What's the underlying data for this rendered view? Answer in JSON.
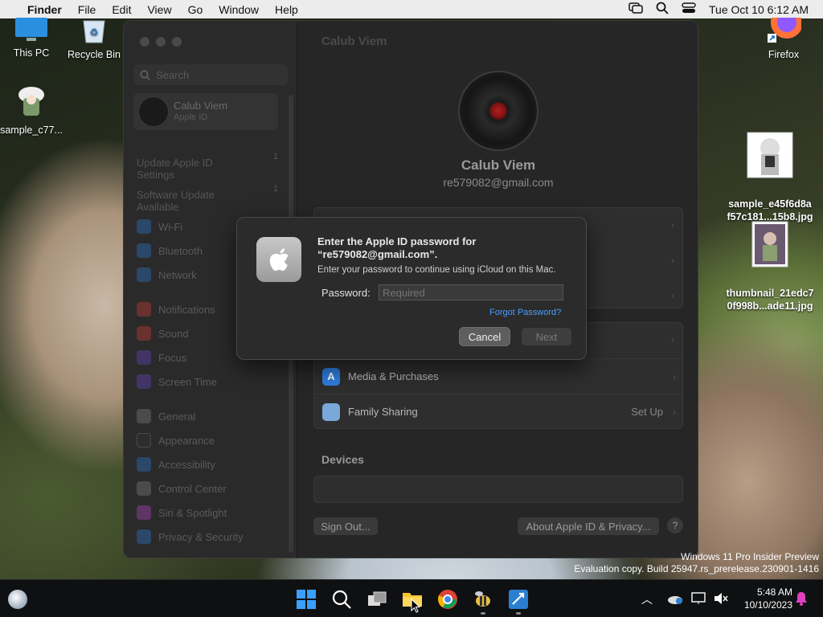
{
  "menubar": {
    "apple": "",
    "app": "Finder",
    "items": [
      "File",
      "Edit",
      "View",
      "Go",
      "Window",
      "Help"
    ],
    "clock": "Tue Oct 10  6:12 AM"
  },
  "desktop": {
    "icons": [
      {
        "label": "This PC"
      },
      {
        "label": "Recycle Bin"
      },
      {
        "label": "sample_c77..."
      },
      {
        "label": "Firefox"
      },
      {
        "label": "sample_e45f6d8a\nf57c181...15b8.jpg"
      },
      {
        "label": "thumbnail_21edc7\n0f998b...ade11.jpg"
      }
    ],
    "watermark": [
      "Windows 11 Pro Insider Preview",
      "Evaluation copy. Build 25947.rs_prerelease.230901-1416"
    ]
  },
  "window": {
    "title": "Calub Viem",
    "search_placeholder": "Search",
    "profile": {
      "name": "Calub Viem",
      "sub": "Apple ID"
    },
    "updates": [
      {
        "label": "Update Apple ID\nSettings",
        "badge": "1"
      },
      {
        "label": "Software Update\nAvailable",
        "badge": "1"
      }
    ],
    "sidebar": [
      "Wi-Fi",
      "Bluetooth",
      "Network",
      "Notifications",
      "Sound",
      "Focus",
      "Screen Time",
      "General",
      "Appearance",
      "Accessibility",
      "Control Center",
      "Siri & Spotlight",
      "Privacy & Security"
    ],
    "header": {
      "name": "Calub Viem",
      "email": "re579082@gmail.com"
    },
    "rows": [
      {
        "label": "Media & Purchases",
        "value": ""
      },
      {
        "label": "Family Sharing",
        "value": "Set Up"
      }
    ],
    "devices_title": "Devices",
    "sign_out": "Sign Out...",
    "about": "About Apple ID & Privacy...",
    "help": "?"
  },
  "dialog": {
    "title": "Enter the Apple ID password for\n“re579082@gmail.com”.",
    "message": "Enter your password to continue using iCloud on this Mac.",
    "password_label": "Password:",
    "password_placeholder": "Required",
    "forgot": "Forgot Password?",
    "cancel": "Cancel",
    "next": "Next"
  },
  "taskbar": {
    "time": "5:48 AM",
    "date": "10/10/2023"
  },
  "colors": {
    "accent": "#3b82f6",
    "link": "#4a9eff"
  }
}
